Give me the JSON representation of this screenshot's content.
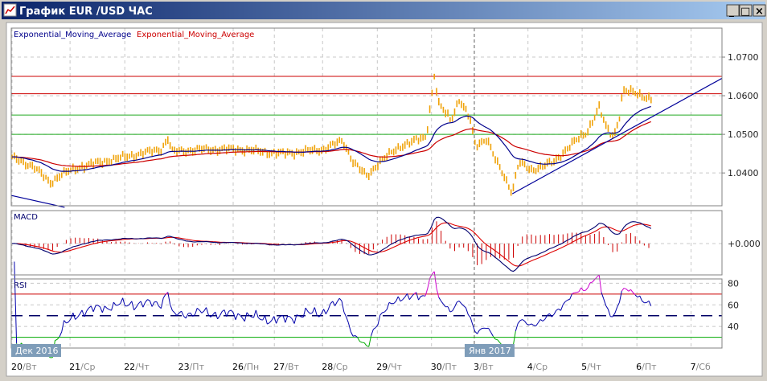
{
  "window": {
    "title": "График EUR /USD  ЧАС",
    "buttons": [
      "_",
      "□",
      "×"
    ]
  },
  "legend": {
    "ema_fast": "Exponential_Moving_Average",
    "ema_slow": "Exponential_Moving_Average"
  },
  "colors": {
    "price": "#f0a30a",
    "ema_fast": "#00008b",
    "ema_slow": "#cc0000",
    "macd": "#00006e",
    "signal": "#dd0000",
    "hist": "#cc0000",
    "rsi": "#0000aa",
    "rsi_over": "#cc00cc",
    "rsi_under": "#00aa00",
    "resistance": "#cc0000",
    "support": "#22aa22",
    "trend": "#000099"
  },
  "panels": {
    "macd_label": "MACD",
    "rsi_label": "RSI"
  },
  "month_labels": [
    {
      "text": "Дек 2016",
      "t": 0
    },
    {
      "text": "Янв 2017",
      "t": 8.53
    }
  ],
  "chart_data": {
    "type": "line",
    "symbol": "EUR/USD",
    "timeframe": "1H",
    "price_axis": {
      "ticks": [
        "1.0700",
        "1.0600",
        "1.0500",
        "1.0400"
      ],
      "tick_values": [
        1.07,
        1.06,
        1.05,
        1.04
      ],
      "range": [
        1.0315,
        1.0775
      ]
    },
    "macd_axis": {
      "ticks": [
        "+0.000"
      ]
    },
    "rsi_axis": {
      "ticks": [
        "80",
        "60",
        "40"
      ],
      "tick_values": [
        80,
        60,
        40
      ],
      "range": [
        20,
        84
      ],
      "levels": [
        70,
        50,
        30
      ]
    },
    "x_ticks": [
      {
        "day": "20",
        "wd": "Вт",
        "t": 0
      },
      {
        "day": "21",
        "wd": "Ср",
        "t": 1.07
      },
      {
        "day": "22",
        "wd": "Чт",
        "t": 2.08
      },
      {
        "day": "23",
        "wd": "Пт",
        "t": 3.08
      },
      {
        "day": "26",
        "wd": "Пн",
        "t": 4.08
      },
      {
        "day": "27",
        "wd": "Вт",
        "t": 4.84
      },
      {
        "day": "28",
        "wd": "Ср",
        "t": 5.73
      },
      {
        "day": "29",
        "wd": "Чт",
        "t": 6.74
      },
      {
        "day": "30",
        "wd": "Пт",
        "t": 7.74
      },
      {
        "day": "3",
        "wd": "Вт",
        "t": 8.53
      },
      {
        "day": "4",
        "wd": "Ср",
        "t": 9.52
      },
      {
        "day": "5",
        "wd": "Чт",
        "t": 10.52
      },
      {
        "day": "6",
        "wd": "Пт",
        "t": 11.53
      },
      {
        "day": "7",
        "wd": "Сб",
        "t": 12.53
      }
    ],
    "x_range": [
      0,
      13.1
    ],
    "price_keypoints": [
      [
        0,
        1.0439
      ],
      [
        0.4,
        1.0417
      ],
      [
        0.7,
        1.0374
      ],
      [
        0.9,
        1.0396
      ],
      [
        1.28,
        1.0417
      ],
      [
        2.0,
        1.0439
      ],
      [
        2.75,
        1.0461
      ],
      [
        2.88,
        1.049
      ],
      [
        2.95,
        1.0455
      ],
      [
        3.5,
        1.0461
      ],
      [
        4.24,
        1.0461
      ],
      [
        4.98,
        1.045
      ],
      [
        5.73,
        1.0461
      ],
      [
        6.1,
        1.0483
      ],
      [
        6.3,
        1.0428
      ],
      [
        6.55,
        1.039
      ],
      [
        6.77,
        1.0428
      ],
      [
        7.2,
        1.0472
      ],
      [
        7.64,
        1.0493
      ],
      [
        7.8,
        1.066
      ],
      [
        7.86,
        1.058
      ],
      [
        8.1,
        1.0537
      ],
      [
        8.25,
        1.0591
      ],
      [
        8.45,
        1.054
      ],
      [
        8.55,
        1.047
      ],
      [
        8.76,
        1.049
      ],
      [
        8.93,
        1.043
      ],
      [
        9.05,
        1.04
      ],
      [
        9.23,
        1.035
      ],
      [
        9.35,
        1.0428
      ],
      [
        9.57,
        1.0407
      ],
      [
        10.0,
        1.0428
      ],
      [
        10.3,
        1.0472
      ],
      [
        10.6,
        1.0504
      ],
      [
        10.83,
        1.057
      ],
      [
        10.97,
        1.0515
      ],
      [
        11.1,
        1.0495
      ],
      [
        11.2,
        1.054
      ],
      [
        11.27,
        1.0613
      ],
      [
        11.5,
        1.0607
      ],
      [
        11.8,
        1.0591
      ]
    ],
    "horizontal_lines": [
      {
        "value": 1.065,
        "kind": "resistance"
      },
      {
        "value": 1.0605,
        "kind": "resistance"
      },
      {
        "value": 1.055,
        "kind": "support"
      },
      {
        "value": 1.05,
        "kind": "support"
      }
    ],
    "trend_lines": [
      {
        "from": [
          9.23,
          1.0346
        ],
        "to": [
          13.1,
          1.0645
        ]
      },
      {
        "from": [
          -0.02,
          1.0342
        ],
        "to": [
          0.97,
          1.0311
        ]
      }
    ],
    "ema_periods": [
      24,
      55
    ],
    "macd_params": [
      12,
      26,
      9
    ],
    "rsi_period": 14
  }
}
